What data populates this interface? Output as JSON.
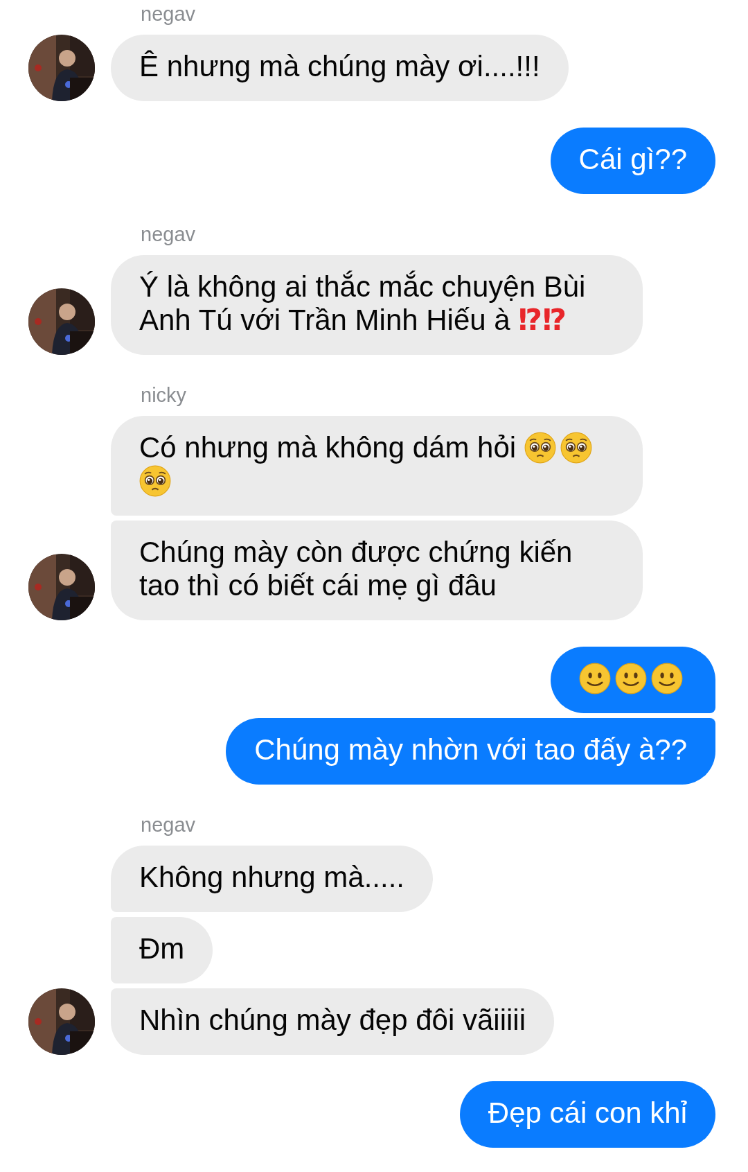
{
  "groups": [
    {
      "outgoing": false,
      "sender": "negav",
      "avatar": {
        "kind": "picture"
      },
      "bubbles": [
        {
          "parts": [
            {
              "kind": "text",
              "text": "Ê nhưng mà chúng mày ơi....!!!"
            }
          ]
        }
      ]
    },
    {
      "outgoing": true,
      "bubbles": [
        {
          "parts": [
            {
              "kind": "text",
              "text": "Cái gì??"
            }
          ]
        }
      ]
    },
    {
      "outgoing": false,
      "sender": "negav",
      "avatar": {
        "kind": "picture"
      },
      "bubbles": [
        {
          "parts": [
            {
              "kind": "text",
              "text": "Ý là không ai thắc mắc chuyện Bùi Anh Tú với Trần Minh Hiếu à "
            },
            {
              "kind": "interrobang",
              "text": "⁉⁉"
            }
          ]
        }
      ]
    },
    {
      "outgoing": false,
      "sender": "nicky",
      "avatar": {
        "kind": "picture"
      },
      "bubbles": [
        {
          "parts": [
            {
              "kind": "text",
              "text": "Có nhưng mà không dám hỏi "
            },
            {
              "kind": "pleading-emoji"
            },
            {
              "kind": "pleading-emoji"
            },
            {
              "kind": "pleading-emoji"
            }
          ]
        },
        {
          "parts": [
            {
              "kind": "text",
              "text": "Chúng mày còn được chứng kiến tao thì có biết cái mẹ gì đâu"
            }
          ]
        }
      ]
    },
    {
      "outgoing": true,
      "bubbles": [
        {
          "parts": [
            {
              "kind": "smile-emoji"
            },
            {
              "kind": "smile-emoji"
            },
            {
              "kind": "smile-emoji"
            }
          ]
        },
        {
          "parts": [
            {
              "kind": "text",
              "text": "Chúng mày nhờn với tao đấy à??"
            }
          ]
        }
      ]
    },
    {
      "outgoing": false,
      "sender": "negav",
      "avatar": {
        "kind": "picture"
      },
      "bubbles": [
        {
          "parts": [
            {
              "kind": "text",
              "text": "Không nhưng mà....."
            }
          ]
        },
        {
          "parts": [
            {
              "kind": "text",
              "text": "Đm"
            }
          ]
        },
        {
          "parts": [
            {
              "kind": "text",
              "text": "Nhìn chúng mày đẹp đôi vãiiiii"
            }
          ]
        }
      ]
    },
    {
      "outgoing": true,
      "bubbles": [
        {
          "parts": [
            {
              "kind": "text",
              "text": "Đẹp cái con khỉ"
            }
          ]
        }
      ]
    }
  ]
}
